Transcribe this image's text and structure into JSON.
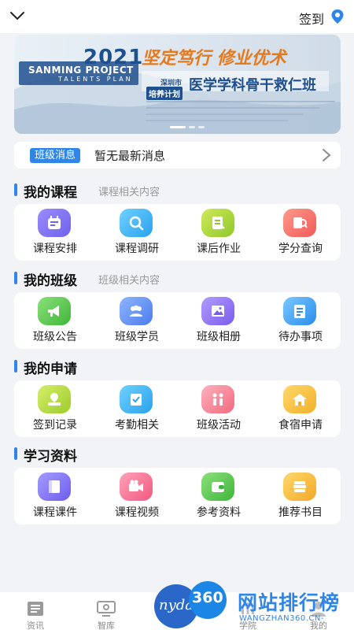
{
  "header": {
    "signin_label": "签到",
    "icons": [
      "chevron-down-icon",
      "location-pin-icon"
    ]
  },
  "banner": {
    "year": "2021",
    "project": "SANMING PROJECT",
    "plan": "TALENTS PLAN",
    "slogan": "坚定笃行 修业优术",
    "city": "深圳市",
    "project_cn": "培养计划",
    "class_name": "医学学科骨干救仁班",
    "dots": 3,
    "active_dot": 1
  },
  "notice": {
    "tag": "班级消息",
    "message": "暂无最新消息"
  },
  "sections": [
    {
      "title": "我的课程",
      "subtitle": "课程相关内容",
      "items": [
        {
          "label": "课程安排",
          "icon": "calendar-icon",
          "color": "#7a72f2"
        },
        {
          "label": "课程调研",
          "icon": "magnifier-icon",
          "color": "#3bb2f0"
        },
        {
          "label": "课后作业",
          "icon": "homework-icon",
          "color": "#a6d33a"
        },
        {
          "label": "学分查询",
          "icon": "search-doc-icon",
          "color": "#f26a6a"
        }
      ]
    },
    {
      "title": "我的班级",
      "subtitle": "班级相关内容",
      "items": [
        {
          "label": "班级公告",
          "icon": "megaphone-icon",
          "color": "#62c94a"
        },
        {
          "label": "班级学员",
          "icon": "students-icon",
          "color": "#5a8cf0"
        },
        {
          "label": "班级相册",
          "icon": "photo-album-icon",
          "color": "#8a6cf0"
        },
        {
          "label": "待办事项",
          "icon": "todo-list-icon",
          "color": "#3ba6f2"
        }
      ]
    },
    {
      "title": "我的申请",
      "subtitle": "",
      "items": [
        {
          "label": "签到记录",
          "icon": "checkin-map-icon",
          "color": "#a6d33a"
        },
        {
          "label": "考勤相关",
          "icon": "attendance-icon",
          "color": "#3bb2f0"
        },
        {
          "label": "班级活动",
          "icon": "activity-people-icon",
          "color": "#f07a8a"
        },
        {
          "label": "食宿申请",
          "icon": "house-icon",
          "color": "#f2c23a"
        }
      ]
    },
    {
      "title": "学习资料",
      "subtitle": "",
      "items": [
        {
          "label": "课程课件",
          "icon": "courseware-icon",
          "color": "#7a72f2"
        },
        {
          "label": "课程视频",
          "icon": "video-camera-icon",
          "color": "#f26a8a"
        },
        {
          "label": "参考资料",
          "icon": "wallet-icon",
          "color": "#62c94a"
        },
        {
          "label": "推荐书目",
          "icon": "books-icon",
          "color": "#f2b83a"
        }
      ]
    }
  ],
  "tabbar": [
    {
      "label": "资讯",
      "icon": "news-icon"
    },
    {
      "label": "智库",
      "icon": "think-tank-icon"
    },
    {
      "label": "学院",
      "icon": "college-icon"
    },
    {
      "label": "我的",
      "icon": "profile-icon"
    }
  ],
  "center_logo": {
    "text": "nydas",
    "badge": "360"
  },
  "watermark": {
    "title": "网站排行榜",
    "url": "WANGZHAN360.CN-"
  }
}
